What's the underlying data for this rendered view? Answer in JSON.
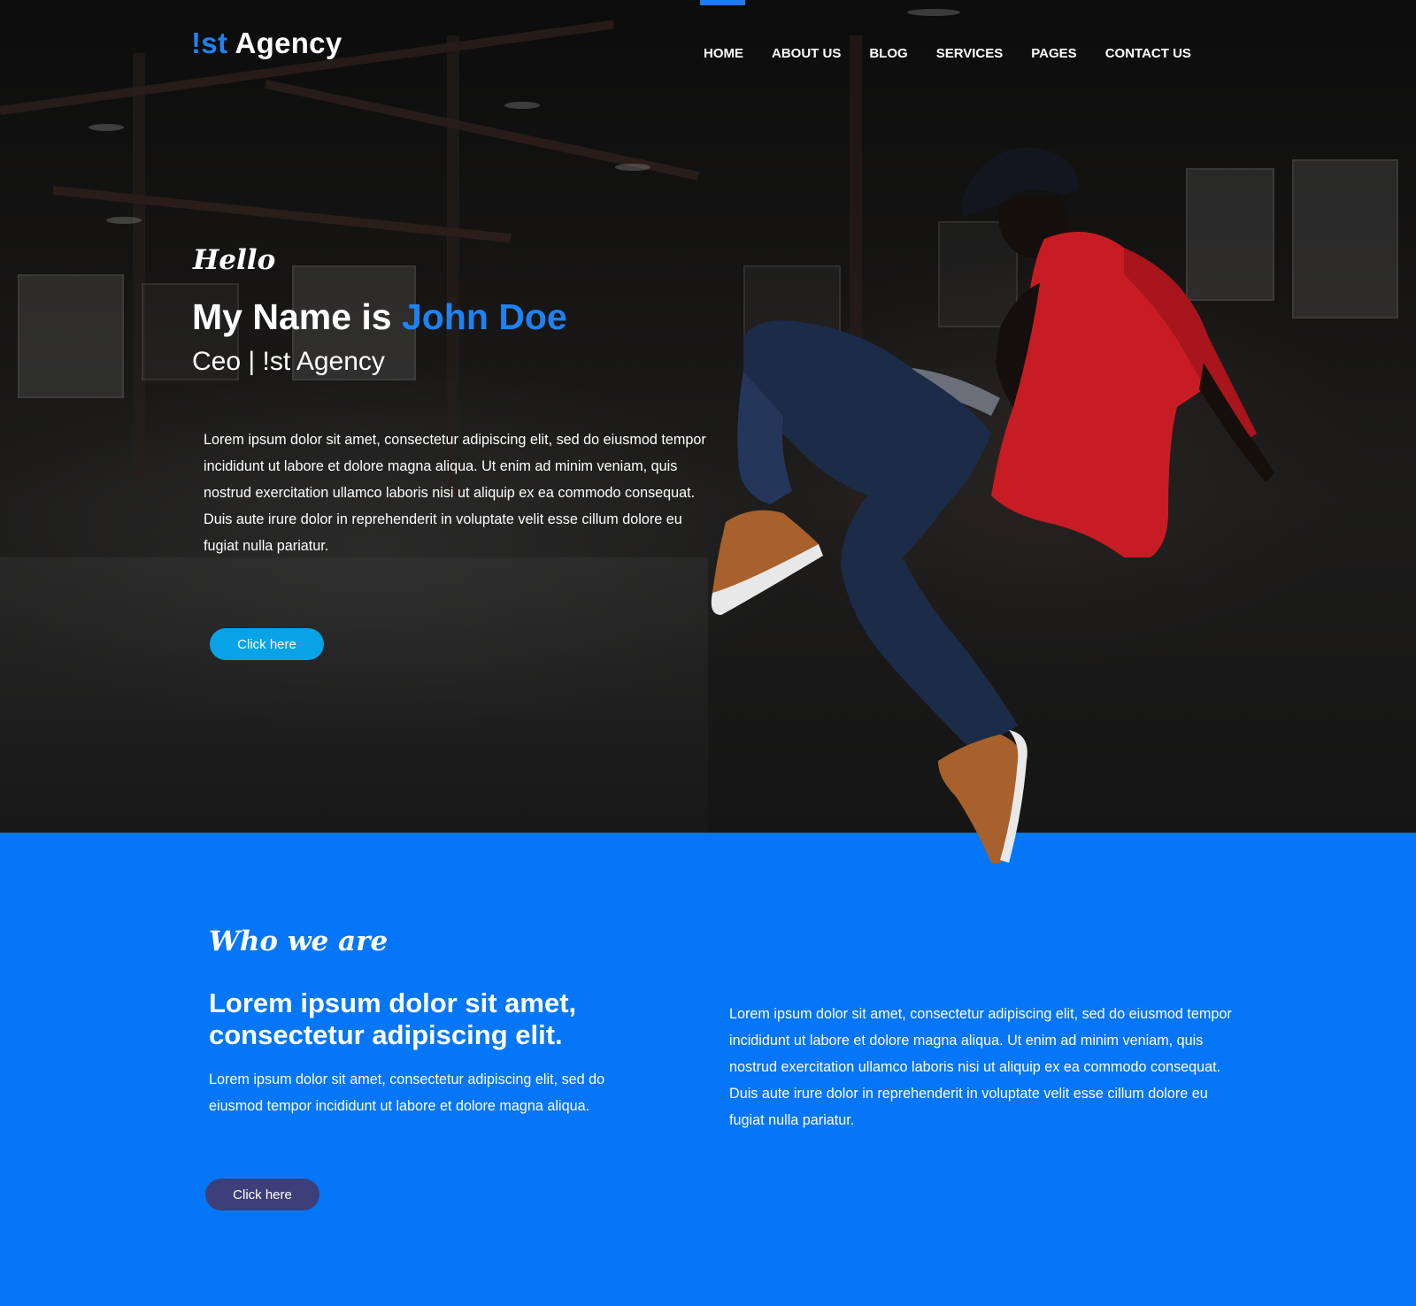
{
  "brand": {
    "logo_mark": "!st",
    "logo_text": " Agency",
    "accent_color": "#1f82f2"
  },
  "nav": {
    "items": [
      {
        "label": "HOME",
        "active": true
      },
      {
        "label": "ABOUT US"
      },
      {
        "label": "BLOG"
      },
      {
        "label": "SERVICES"
      },
      {
        "label": "PAGES"
      },
      {
        "label": "CONTACT US"
      }
    ]
  },
  "hero": {
    "greeting": "Hello",
    "name_prefix": "My Name is ",
    "name_highlight": "John Doe",
    "role": "Ceo |  !st Agency",
    "paragraph": "Lorem ipsum dolor sit amet, consectetur adipiscing elit, sed do eiusmod tempor incididunt ut labore et dolore magna aliqua. Ut enim ad minim veniam, quis nostrud exercitation ullamco laboris nisi ut aliquip ex ea commodo consequat. Duis aute irure dolor in reprehenderit in voluptate velit esse cillum dolore eu fugiat nulla pariatur.",
    "button_label": "Click here",
    "button_color": "#08a3e6"
  },
  "about": {
    "script_title": "Who we are",
    "heading": "Lorem ipsum dolor sit amet, consectetur adipiscing elit.",
    "subtext": "Lorem ipsum dolor sit amet, consectetur adipiscing elit, sed do eiusmod tempor incididunt ut labore et dolore magna aliqua.",
    "button_label": "Click here",
    "button_color": "#3d3f7a",
    "paragraph": "Lorem ipsum dolor sit amet, consectetur adipiscing elit, sed do eiusmod tempor incididunt ut labore et dolore magna aliqua. Ut enim ad minim veniam, quis nostrud exercitation ullamco laboris nisi ut aliquip ex ea commodo consequat. Duis aute irure dolor in reprehenderit in voluptate velit esse cillum dolore eu fugiat nulla pariatur.",
    "background_color": "#0476f7"
  }
}
